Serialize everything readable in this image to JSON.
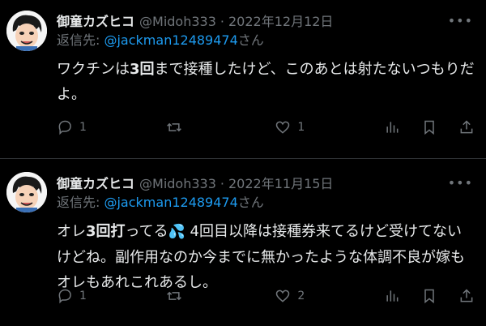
{
  "tweets": [
    {
      "name": "御童カズヒコ",
      "handle": "@Midoh333",
      "dot": "·",
      "date": "2022年12月12日",
      "reply_prefix": "返信先: ",
      "reply_to": "@jackman12489474",
      "reply_suffix": "さん",
      "text_a": "ワクチンは",
      "text_bold": "3回",
      "text_b": "まで接種したけど、このあとは射たないつもりだよ。",
      "replies": "1",
      "retweets": "",
      "likes": "1"
    },
    {
      "name": "御童カズヒコ",
      "handle": "@Midoh333",
      "dot": "·",
      "date": "2022年11月15日",
      "reply_prefix": "返信先: ",
      "reply_to": "@jackman12489474",
      "reply_suffix": "さん",
      "text_a": "オレ",
      "text_bold": "3回打",
      "text_b": "ってる",
      "emoji": "💦",
      "text_c": " 4回目以降は接種券来てるけど受けてないけどね。副作用なのか今までに無かったような体調不良が嫁もオレもあれこれあるし。",
      "replies": "1",
      "retweets": "",
      "likes": "2"
    }
  ],
  "icons": {
    "reply": "reply-icon",
    "retweet": "retweet-icon",
    "like": "heart-icon",
    "views": "views-icon",
    "bookmark": "bookmark-icon",
    "share": "share-icon",
    "more": "more-icon"
  },
  "colors": {
    "background": "#000000",
    "text": "#e7e9ea",
    "muted": "#71767b",
    "link": "#1d9bf0"
  }
}
